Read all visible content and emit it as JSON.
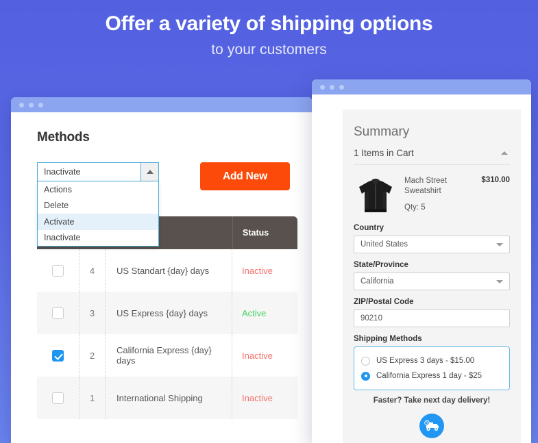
{
  "hero": {
    "title": "Offer a variety of shipping options",
    "subtitle": "to your customers"
  },
  "admin_window": {
    "page_title": "Methods",
    "action_select": {
      "selected": "Inactivate",
      "options": [
        {
          "label": "Actions",
          "highlighted": false
        },
        {
          "label": "Delete",
          "highlighted": false
        },
        {
          "label": "Activate",
          "highlighted": true
        },
        {
          "label": "Inactivate",
          "highlighted": false
        }
      ]
    },
    "add_new_label": "Add New",
    "table": {
      "headers": {
        "status": "Status"
      },
      "rows": [
        {
          "id": "4",
          "name": "US Standart {day} days",
          "status": "Inactive",
          "checked": false
        },
        {
          "id": "3",
          "name": "US Express {day} days",
          "status": "Active",
          "checked": false
        },
        {
          "id": "2",
          "name": "California Express {day} days",
          "status": "Inactive",
          "checked": true
        },
        {
          "id": "1",
          "name": "International Shipping",
          "status": "Inactive",
          "checked": false
        }
      ]
    }
  },
  "cart_window": {
    "summary_title": "Summary",
    "items_in_cart": "1 Items in Cart",
    "item": {
      "name": "Mach Street Sweatshirt",
      "price": "$310.00",
      "qty": "Qty: 5"
    },
    "country": {
      "label": "Country",
      "value": "United States"
    },
    "state": {
      "label": "State/Province",
      "value": "California"
    },
    "zip": {
      "label": "ZIP/Postal Code",
      "value": "90210"
    },
    "shipping": {
      "label": "Shipping Methods",
      "options": [
        {
          "label": "US Express 3 days - $15.00",
          "selected": false
        },
        {
          "label": "California Express 1 day - $25",
          "selected": true
        }
      ]
    },
    "promo": "Faster? Take next day delivery!"
  },
  "colors": {
    "accent_orange": "#fc4a0a",
    "accent_blue": "#1e96f0",
    "status_active": "#3fd35f",
    "status_inactive": "#f2716b",
    "background_top": "#5360e0",
    "background_bottom": "#6b84ef"
  }
}
